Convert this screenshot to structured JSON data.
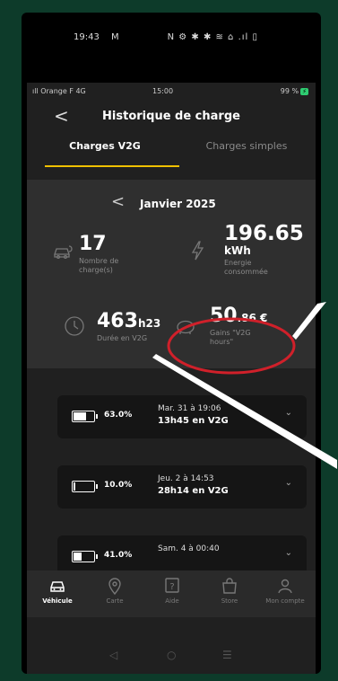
{
  "outer_status": {
    "time": "19:43",
    "mail": "M",
    "icons": "N ⚙ ✱ ✱ ≋ ⌂ .ıl ▯"
  },
  "status": {
    "carrier": "ıll Orange F 4G",
    "time": "15:00",
    "battery": "99 %",
    "battery_badge": "⚡"
  },
  "header": {
    "back": "<",
    "title": "Historique de charge"
  },
  "tabs": [
    {
      "label": "Charges V2G",
      "active": true
    },
    {
      "label": "Charges simples",
      "active": false
    }
  ],
  "month": {
    "prev": "<",
    "label": "Janvier 2025"
  },
  "stats": {
    "charges": {
      "value": "17",
      "sub1": "Nombre de",
      "sub2": "charge(s)"
    },
    "energy": {
      "value": "196.65",
      "unit": "kWh",
      "sub1": "Energie",
      "sub2": "consommée"
    },
    "duration": {
      "value": "463",
      "unit": "h23",
      "sub": "Durée en V2G"
    },
    "gains": {
      "value": "50",
      "unit": ".86 €",
      "sub1": "Gains \"V2G",
      "sub2": "hours\""
    }
  },
  "charges": [
    {
      "pct": "63.0%",
      "fill": 0.63,
      "date": "Mar. 31 à 19:06",
      "duration": "13h45 en V2G",
      "arrow": "⌄"
    },
    {
      "pct": "10.0%",
      "fill": 0.1,
      "date": "Jeu. 2 à 14:53",
      "duration": "28h14 en V2G",
      "arrow": "⌄"
    },
    {
      "pct": "41.0%",
      "fill": 0.41,
      "date": "Sam. 4 à 00:40",
      "duration": "",
      "arrow": "⌄"
    }
  ],
  "tabbar": [
    {
      "label": "Véhicule",
      "icon": "car-icon",
      "active": true
    },
    {
      "label": "Carte",
      "icon": "map-pin-icon",
      "active": false
    },
    {
      "label": "Aide",
      "icon": "help-icon",
      "active": false
    },
    {
      "label": "Store",
      "icon": "bag-icon",
      "active": false
    },
    {
      "label": "Mon compte",
      "icon": "user-icon",
      "active": false
    }
  ],
  "navbar": {
    "back": "◁",
    "home": "○",
    "recent": "☰"
  },
  "colors": {
    "accent": "#f0c000",
    "annotation": "#d0202a",
    "background": "#0d3b2a"
  }
}
